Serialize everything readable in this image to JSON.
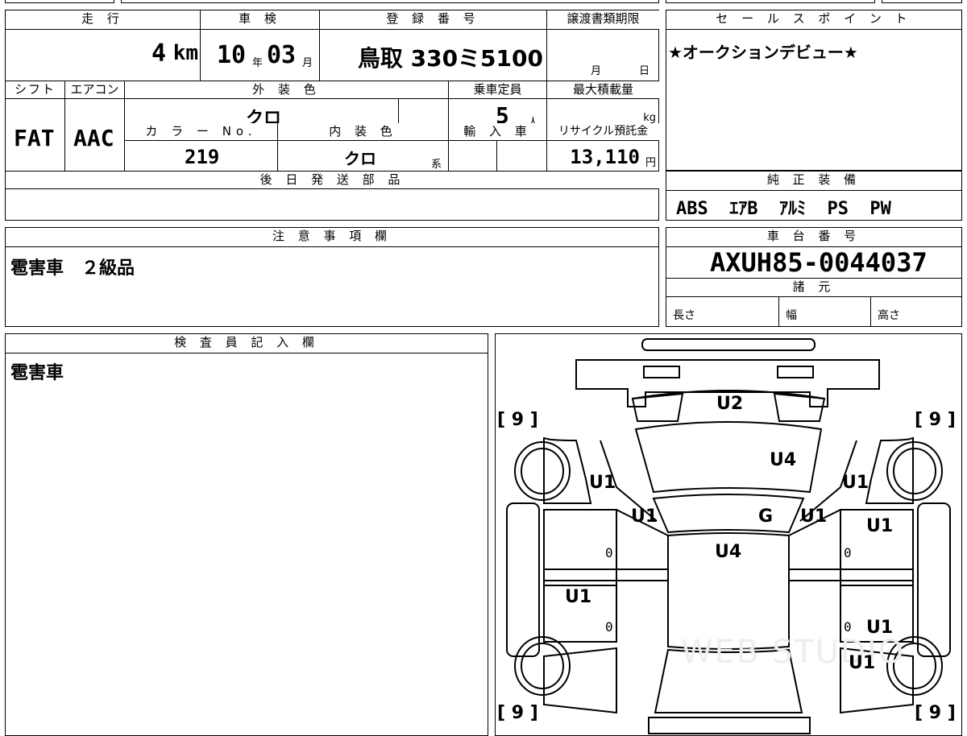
{
  "top": {
    "mileage_label": "走 行",
    "mileage_value": "4",
    "mileage_unit": "km",
    "inspection_label": "車 検",
    "inspection_year": "10",
    "inspection_year_unit": "年",
    "inspection_month": "03",
    "inspection_month_unit": "月",
    "registration_label": "登 録 番 号",
    "registration_value": "鳥取 330ミ5100",
    "transfer_label": "譲渡書類期限",
    "transfer_month": "月",
    "transfer_day": "日"
  },
  "row2": {
    "shift_label": "シフト",
    "shift_value": "FAT",
    "ac_label": "エアコン",
    "ac_value": "AAC",
    "exterior_label": "外 装 色",
    "exterior_value": "クロ",
    "capacity_label": "乗車定員",
    "capacity_value": "5",
    "capacity_unit": "人",
    "load_label": "最大積載量",
    "load_unit": "kg",
    "color_no_label": "カ ラ ー No.",
    "color_no_value": "219",
    "interior_label": "内 装 色",
    "interior_value": "クロ",
    "interior_unit": "系",
    "import_label": "輸 入 車",
    "recycle_label": "リサイクル預託金",
    "recycle_value": "13,110",
    "recycle_unit": "円"
  },
  "later_parts": {
    "label": "後 日 発 送 部 品",
    "value": ""
  },
  "sales_point": {
    "label": "セ ー ル ス ポ イ ン ト",
    "value": "★オークションデビュー★"
  },
  "equipment": {
    "label": "純 正 装 備",
    "value": "ABS  ｴｱB  ｱﾙﾐ  PS  PW"
  },
  "notes": {
    "label": "注 意 事 項 欄",
    "value": "雹害車　２級品"
  },
  "chassis": {
    "label": "車 台 番 号",
    "value": "AXUH85-0044037",
    "specs_label": "諸 元",
    "length_label": "長さ",
    "width_label": "幅",
    "height_label": "高さ"
  },
  "inspector": {
    "label": "検 査 員 記 入 欄",
    "value": "雹害車"
  },
  "diagram": {
    "marks": {
      "u2": "U2",
      "u4_hood": "U4",
      "u1_front_left": "U1",
      "u1_front_right": "U1",
      "u1_pillar_left": "U1",
      "g_windshield": "G",
      "u1_pillar_right": "U1",
      "u4_roof": "U4",
      "u1_door_right": "U1",
      "u1_rear_door_left": "U1",
      "u1_rear_door_right": "U1",
      "u1_rear_right": "U1"
    },
    "tires": {
      "fl": "9",
      "fr": "9",
      "rl": "9",
      "rr": "9"
    },
    "zeros": {
      "z1": "0",
      "z2": "0",
      "z3": "0",
      "z4": "0"
    },
    "watermark": "WEB STUDIO"
  }
}
